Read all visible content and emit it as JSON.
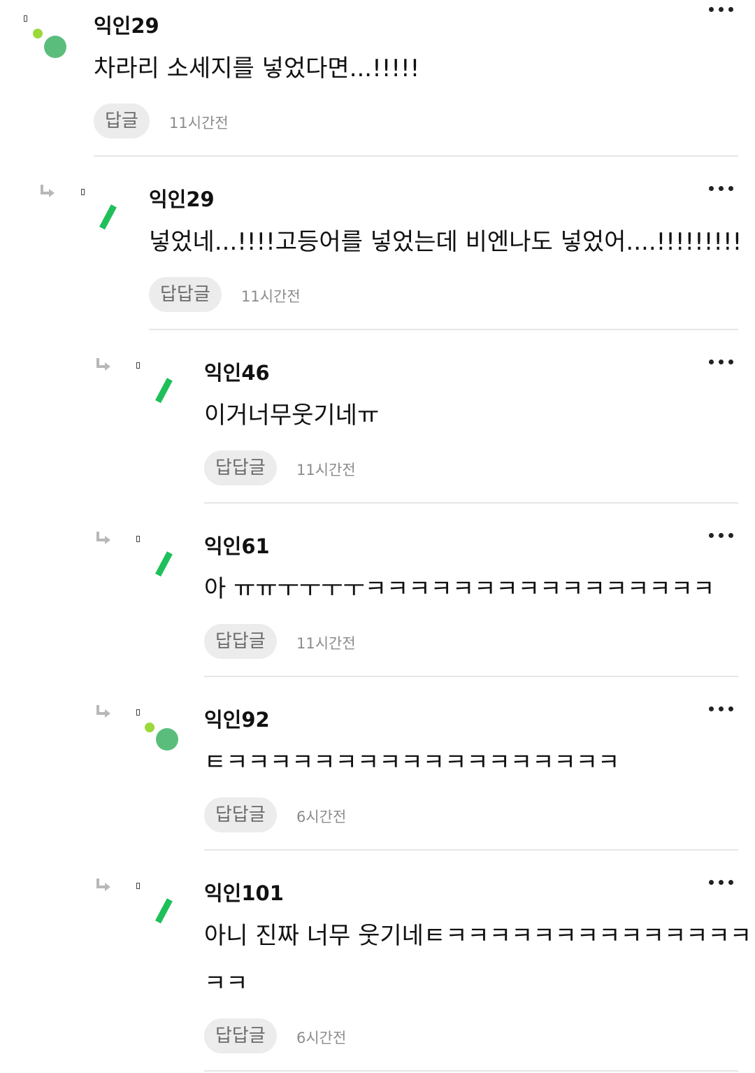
{
  "comments": [
    {
      "author": "익인29",
      "text": "차라리 소세지를 넣었다면...!!!!!",
      "reply_label": "답글",
      "time": "11시간전",
      "avatar": "dots-avatar"
    },
    {
      "author": "익인29",
      "text": "넣었네...!!!!고등어를 넣었는데 비엔나도 넣었어....!!!!!!!!!",
      "reply_label": "답답글",
      "time": "11시간전",
      "avatar": "slash-avatar"
    },
    {
      "author": "익인46",
      "text": "이거너무웃기네ㅠ",
      "reply_label": "답답글",
      "time": "11시간전",
      "avatar": "slash-avatar"
    },
    {
      "author": "익인61",
      "text": "아 ㅠㅠㅜㅜㅜㅜㅋㅋㅋㅋㅋㅋㅋㅋㅋㅋㅋㅋㅋㅋㅋㅋ",
      "reply_label": "답답글",
      "time": "11시간전",
      "avatar": "slash-avatar"
    },
    {
      "author": "익인92",
      "text": "ㅌㅋㅋㅋㅋㅋㅋㅋㅋㅋㅋㅋㅋㅋㅋㅋㅋㅋㅋ",
      "reply_label": "답답글",
      "time": "6시간전",
      "avatar": "dots-avatar"
    },
    {
      "author": "익인101",
      "text_line1": "아니 진짜 너무 웃기네ㅌㅋㅋㅋㅋㅋㅋㅋㅋㅋㅋㅋㅋㅋㅋㅋ",
      "text_line2": "ㅋㅋ",
      "reply_label": "답답글",
      "time": "6시간전",
      "avatar": "slash-avatar"
    }
  ],
  "colors": {
    "green": "#5bbd7c",
    "lime": "#9bd93a",
    "slash": "#1fbf5a",
    "bubble": "#ececec"
  }
}
